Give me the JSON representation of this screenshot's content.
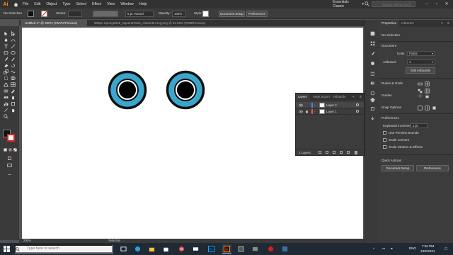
{
  "app": {
    "logo": "Ai",
    "menu": [
      "File",
      "Edit",
      "Object",
      "Type",
      "Select",
      "Effect",
      "View",
      "Window",
      "Help"
    ],
    "workspace": "Essentials Classic",
    "help_search_placeholder": "Search Adobe Stock"
  },
  "control_bar": {
    "selection_label": "No Selection",
    "stroke_label": "Stroke:",
    "brush_value": "5 pt. Round",
    "opacity_label": "Opacity:",
    "opacity_value": "100%",
    "style_label": "Style:",
    "doc_setup_label": "Document Setup",
    "preferences_label": "Preferences"
  },
  "tabs": [
    {
      "label": "Untitled-1* @ 200% (CMYK/Preview)"
    },
    {
      "label": "800px-SpongeBob_SquarePants_character.svg.png @ 51.66% (RGB/Preview)"
    }
  ],
  "status": {
    "zoom": "200%",
    "tool": "Selection"
  },
  "layers_panel": {
    "tabs": [
      "Layers",
      "Asset Export",
      "Artboards"
    ],
    "layers": [
      {
        "name": "Layer 2",
        "color": "#4f7cff"
      },
      {
        "name": "Layer 1",
        "color": "#ff4f4f"
      }
    ],
    "footer_count": "2 Layers"
  },
  "properties_panel": {
    "tabs": [
      "Properties",
      "Libraries"
    ],
    "selection": "No Selection",
    "document_header": "Document",
    "units_label": "Units:",
    "units_value": "Points",
    "artboard_label": "Artboard:",
    "artboard_value": "1",
    "edit_artboards_label": "Edit Artboards",
    "rulers_grids_label": "Rulers & Grids",
    "guides_label": "Guides",
    "snap_options_label": "Snap Options",
    "preferences_header": "Preferences",
    "keyboard_increment_label": "Keyboard Increment:",
    "keyboard_increment_value": "1 pt",
    "checkboxes": [
      "Use Preview Bounds",
      "Scale Corners",
      "Scale Strokes & Effects"
    ],
    "quick_actions_header": "Quick Actions",
    "document_setup_btn": "Document Setup",
    "preferences_btn": "Preferences"
  },
  "taskbar": {
    "search_placeholder": "Type here to search",
    "language": "ENG",
    "time": "7:04 PM",
    "date": "13/2/2021"
  },
  "colors": {
    "eye_ring": "#3aa6cc",
    "eye_outline": "#111111",
    "accent": "#ff9a00"
  }
}
